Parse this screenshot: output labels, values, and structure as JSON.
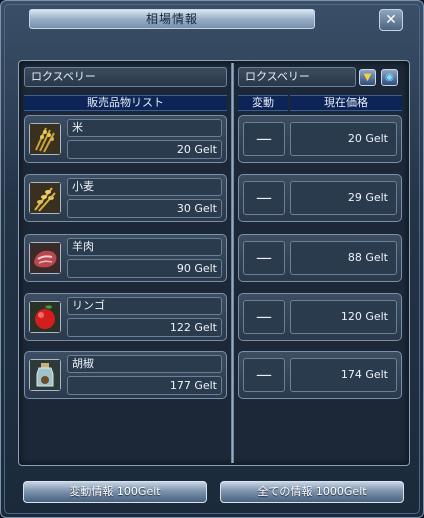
{
  "window": {
    "title": "相場情報",
    "close_label": "✕"
  },
  "left_panel": {
    "location": "ロクスベリー",
    "list_header": "販売品物リスト",
    "items": [
      {
        "name": "米",
        "price": "20 Gelt",
        "icon": "rice-icon"
      },
      {
        "name": "小麦",
        "price": "30 Gelt",
        "icon": "wheat-icon"
      },
      {
        "name": "羊肉",
        "price": "90 Gelt",
        "icon": "meat-icon"
      },
      {
        "name": "リンゴ",
        "price": "122 Gelt",
        "icon": "apple-icon"
      },
      {
        "name": "胡椒",
        "price": "177 Gelt",
        "icon": "pepper-icon"
      }
    ]
  },
  "right_panel": {
    "location": "ロクスベリー",
    "col_change": "変動",
    "col_current": "現在価格",
    "rows": [
      {
        "change": "—",
        "price": "20 Gelt"
      },
      {
        "change": "—",
        "price": "29 Gelt"
      },
      {
        "change": "—",
        "price": "88 Gelt"
      },
      {
        "change": "—",
        "price": "120 Gelt"
      },
      {
        "change": "—",
        "price": "174 Gelt"
      }
    ]
  },
  "buttons": {
    "change_info": "変動情報 100Gelt",
    "all_info": "全ての情報 1000Gelt"
  },
  "colors": {
    "accent": "#0c2456",
    "panel": "#1c2838",
    "border": "#7a8fa8"
  }
}
